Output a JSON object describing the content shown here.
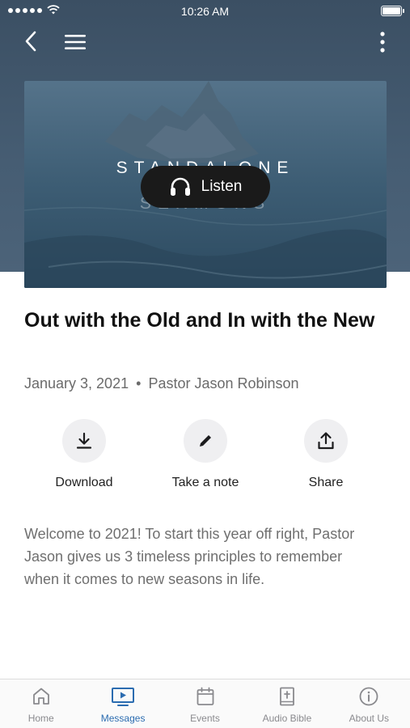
{
  "status_bar": {
    "time": "10:26 AM"
  },
  "hero": {
    "title_line1": "STANDALONE",
    "title_line2": "SERMONS",
    "listen_label": "Listen"
  },
  "sermon": {
    "title": "Out with the Old and In with the New",
    "date": "January 3, 2021",
    "separator": "•",
    "speaker": "Pastor Jason Robinson",
    "description": "Welcome to 2021! To start this year off right, Pastor Jason gives us 3 timeless principles to remember when it comes to new seasons in life."
  },
  "actions": [
    {
      "label": "Download",
      "icon": "download-icon"
    },
    {
      "label": "Take a note",
      "icon": "pencil-icon"
    },
    {
      "label": "Share",
      "icon": "share-icon"
    }
  ],
  "tabs": [
    {
      "label": "Home",
      "icon": "home-icon",
      "active": false
    },
    {
      "label": "Messages",
      "icon": "tv-play-icon",
      "active": true
    },
    {
      "label": "Events",
      "icon": "calendar-icon",
      "active": false
    },
    {
      "label": "Audio Bible",
      "icon": "bible-icon",
      "active": false
    },
    {
      "label": "About Us",
      "icon": "info-icon",
      "active": false
    }
  ],
  "colors": {
    "header": "#465d73",
    "accent": "#2b6cb0",
    "inactive": "#8a8a8e"
  }
}
